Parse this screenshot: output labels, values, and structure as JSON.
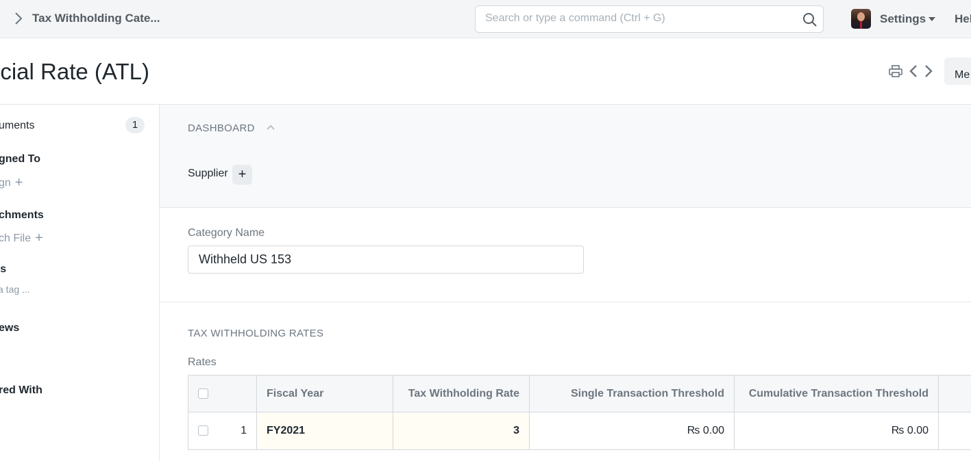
{
  "topbar": {
    "breadcrumb": "Tax Withholding Cate...",
    "search_placeholder": "Search or type a command (Ctrl + G)",
    "settings_label": "Settings",
    "help_label": "Hel"
  },
  "page": {
    "title": "ecial Rate (ATL)",
    "menu_label": "Me"
  },
  "sidebar": {
    "comments_label": "uments",
    "comments_count": "1",
    "assigned_to": "gned To",
    "assign": "gn",
    "attachments": "chments",
    "attach_file": "ch File",
    "tags": "Tags",
    "add_tag": "a tag ...",
    "reviews": "ews",
    "shared_with": "red With"
  },
  "dashboard": {
    "title": "DASHBOARD",
    "supplier_label": "Supplier"
  },
  "form": {
    "category_label": "Category Name",
    "category_value": "Withheld US 153"
  },
  "rates_section": {
    "title": "TAX WITHHOLDING RATES",
    "table_label": "Rates",
    "columns": [
      "Fiscal Year",
      "Tax Withholding Rate",
      "Single Transaction Threshold",
      "Cumulative Transaction Threshold"
    ],
    "rows": [
      {
        "idx": "1",
        "fiscal_year": "FY2021",
        "rate": "3",
        "single": "₨ 0.00",
        "cumulative": "₨ 0.00"
      }
    ]
  },
  "icons": [
    "chevron-right-icon",
    "search-icon",
    "caret-down-icon",
    "print-icon",
    "chevron-left-icon",
    "chevron-right-icon",
    "chevron-up-icon",
    "plus-icon"
  ]
}
